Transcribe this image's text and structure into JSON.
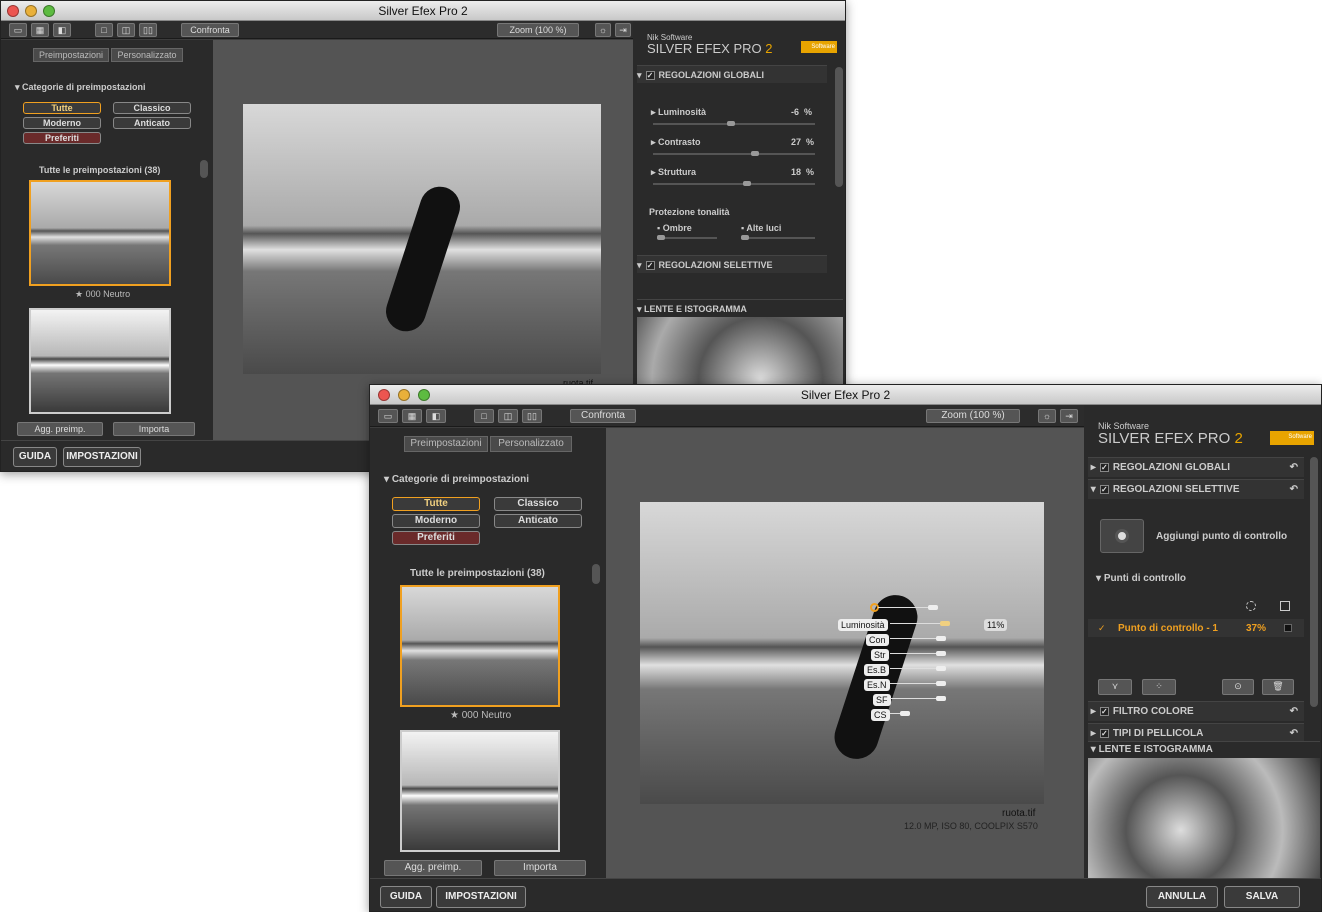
{
  "app_title": "Silver Efex Pro 2",
  "toolbar": {
    "confronta": "Confronta",
    "zoom": "Zoom (100 %)"
  },
  "tabs": {
    "preimpostazioni": "Preimpostazioni",
    "personalizzato": "Personalizzato"
  },
  "categories": {
    "header": "Categorie di preimpostazioni",
    "tutte": "Tutte",
    "classico": "Classico",
    "moderno": "Moderno",
    "anticato": "Anticato",
    "preferiti": "Preferiti"
  },
  "presets": {
    "header": "Tutte le preimpostazioni (38)",
    "first_name": "000 Neutro",
    "add": "Agg. preimp.",
    "import": "Importa"
  },
  "bottom": {
    "guida": "GUIDA",
    "impostazioni": "IMPOSTAZIONI",
    "annulla": "ANNULLA",
    "salva": "SALVA"
  },
  "brand": {
    "vendor": "Nik Software",
    "product": "SILVER EFEX PRO",
    "version": "2",
    "logo": "Software"
  },
  "panel1": {
    "global_title": "REGOLAZIONI GLOBALI",
    "luminosita_label": "Luminosità",
    "luminosita_value": "-6",
    "luminosita_unit": "%",
    "contrasto_label": "Contrasto",
    "contrasto_value": "27",
    "contrasto_unit": "%",
    "struttura_label": "Struttura",
    "struttura_value": "18",
    "struttura_unit": "%",
    "protezione": "Protezione tonalità",
    "ombre": "Ombre",
    "alte_luci": "Alte luci",
    "selective_title": "REGOLAZIONI SELETTIVE",
    "lente_title": "LENTE E ISTOGRAMMA"
  },
  "panel2": {
    "global_title": "REGOLAZIONI GLOBALI",
    "selective_title": "REGOLAZIONI SELETTIVE",
    "add_cp": "Aggiungi punto di controllo",
    "punti": "Punti di controllo",
    "cp_name": "Punto di controllo - 1",
    "cp_value": "37%",
    "filtro": "FILTRO COLORE",
    "pellicola": "TIPI DI PELLICOLA",
    "lente_title": "LENTE E ISTOGRAMMA"
  },
  "file": {
    "name": "ruota.tif",
    "info": "12.0 MP, ISO 80, COOLPIX S570"
  },
  "control_point": {
    "labels": [
      "Luminosità",
      "Con",
      "Str",
      "Es.B",
      "Es.N",
      "SF",
      "CS"
    ],
    "lum_value": "11%"
  },
  "colors": {
    "accent": "#f0a020",
    "brand_yellow": "#e8a400"
  }
}
